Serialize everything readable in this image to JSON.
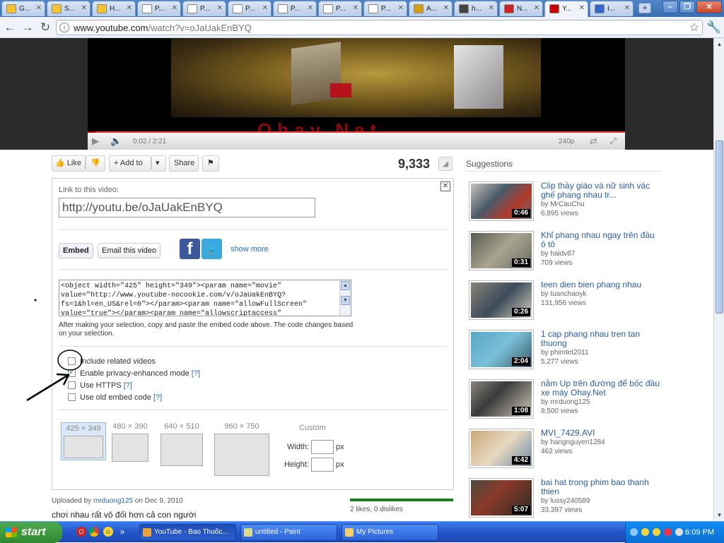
{
  "browser": {
    "tabs": [
      {
        "label": "G...",
        "icon": "chat-icon",
        "color": "#f4c430"
      },
      {
        "label": "S...",
        "icon": "chat-icon",
        "color": "#f4c430"
      },
      {
        "label": "H...",
        "icon": "chat-icon",
        "color": "#f4c430"
      },
      {
        "label": "P...",
        "icon": "page-icon",
        "color": "#ffffff"
      },
      {
        "label": "P...",
        "icon": "page-icon",
        "color": "#ffffff"
      },
      {
        "label": "P...",
        "icon": "page-icon",
        "color": "#ffffff"
      },
      {
        "label": "P...",
        "icon": "page-icon",
        "color": "#ffffff"
      },
      {
        "label": "P...",
        "icon": "page-icon",
        "color": "#ffffff"
      },
      {
        "label": "P...",
        "icon": "page-icon",
        "color": "#ffffff"
      },
      {
        "label": "A...",
        "icon": "circle-icon",
        "color": "#d4a017"
      },
      {
        "label": "h...",
        "icon": "camera-icon",
        "color": "#444444"
      },
      {
        "label": "N...",
        "icon": "news-icon",
        "color": "#cc2222"
      },
      {
        "label": "Y...",
        "icon": "youtube-icon",
        "color": "#cc0000",
        "active": true
      },
      {
        "label": "I...",
        "icon": "image-icon",
        "color": "#3366cc"
      }
    ],
    "new_tab": "+",
    "window_buttons": [
      "–",
      "❐",
      "✕"
    ],
    "url_domain": "www.youtube.com",
    "url_path": "/watch?v=oJaUakEnBYQ",
    "back_icon": "←",
    "forward_icon": "→",
    "reload_icon": "↻",
    "star_icon": "☆",
    "wrench_icon": "🔧"
  },
  "player": {
    "watermark": "Ohay.Net",
    "time": "0:02 / 2:21",
    "quality": "240p",
    "progress_fraction": 0.015
  },
  "actions": {
    "like": "Like",
    "add_to": "Add to",
    "share": "Share",
    "views": "9,333"
  },
  "share": {
    "link_label": "Link to this video:",
    "short_url": "http://youtu.be/oJaUakEnBYQ",
    "embed_btn": "Embed",
    "email_btn": "Email this video",
    "show_more": "show more",
    "embed_code": "<object width=\"425\" height=\"349\"><param name=\"movie\" value=\"http://www.youtube-nocookie.com/v/oJaUakEnBYQ?fs=1&hl=en_US&rel=0\"></param><param name=\"allowFullScreen\" value=\"true\"></param><param name=\"allowscriptaccess\"",
    "help_text": "After making your selection, copy and paste the embed code above. The code changes based on your selection.",
    "options": [
      {
        "label": "Include related videos",
        "checked": false,
        "help": ""
      },
      {
        "label": "Enable privacy-enhanced mode",
        "checked": true,
        "help": "[?]"
      },
      {
        "label": "Use HTTPS",
        "checked": false,
        "help": "[?]"
      },
      {
        "label": "Use old embed code",
        "checked": false,
        "help": "[?]"
      }
    ],
    "sizes": [
      "425 × 349",
      "480 × 390",
      "640 × 510",
      "960 × 750"
    ],
    "custom_label": "Custom",
    "width_label": "Width:",
    "height_label": "Height:",
    "px": "px"
  },
  "info": {
    "uploaded_prefix": "Uploaded by",
    "uploader": "mrduong125",
    "uploaded_date": "on Dec 9, 2010",
    "description": "chơi nhau rất vô đối hơn cả con người",
    "likes": "2 likes, 0 dislikes"
  },
  "suggestions": {
    "heading": "Suggestions",
    "items": [
      {
        "title": "Clip thầy giáo và nữ sinh vác ghế phang nhau tr...",
        "by": "by MrCauChu",
        "views": "6,895 views",
        "duration": "0:46"
      },
      {
        "title": "Khỉ phang nhau ngay trên đầu ô tô",
        "by": "by haidv87",
        "views": "709 views",
        "duration": "0:31"
      },
      {
        "title": "teen dien bien phang nhau",
        "by": "by tuanchaoyk",
        "views": "131,956 views",
        "duration": "0:26"
      },
      {
        "title": "1 cap phang nhau tren tan thuong",
        "by": "by phimtet2011",
        "views": "5,277 views",
        "duration": "2:04"
      },
      {
        "title": "nằm Up trên đường để bốc đầu xe máy Ohay.Net",
        "by": "by mrduong125",
        "views": "8,500 views",
        "duration": "1:08"
      },
      {
        "title": "MVI_7429.AVI",
        "by": "by hangnguyen1284",
        "views": "462 views",
        "duration": "4:42"
      },
      {
        "title": "bai hat trong phim bao thanh thien",
        "by": "by lussy240589",
        "views": "33,397 views",
        "duration": "5:07"
      }
    ]
  },
  "taskbar": {
    "start": "start",
    "tasks": [
      {
        "label": "YouTube - Bao Thuốc...",
        "color": "#e8a33a",
        "active": true
      },
      {
        "label": "untitled - Paint",
        "color": "#d9d98a",
        "active": false
      },
      {
        "label": "My Pictures",
        "color": "#f0d070",
        "active": false
      }
    ],
    "clock": "6:09 PM",
    "quicklaunch_more": "»"
  }
}
